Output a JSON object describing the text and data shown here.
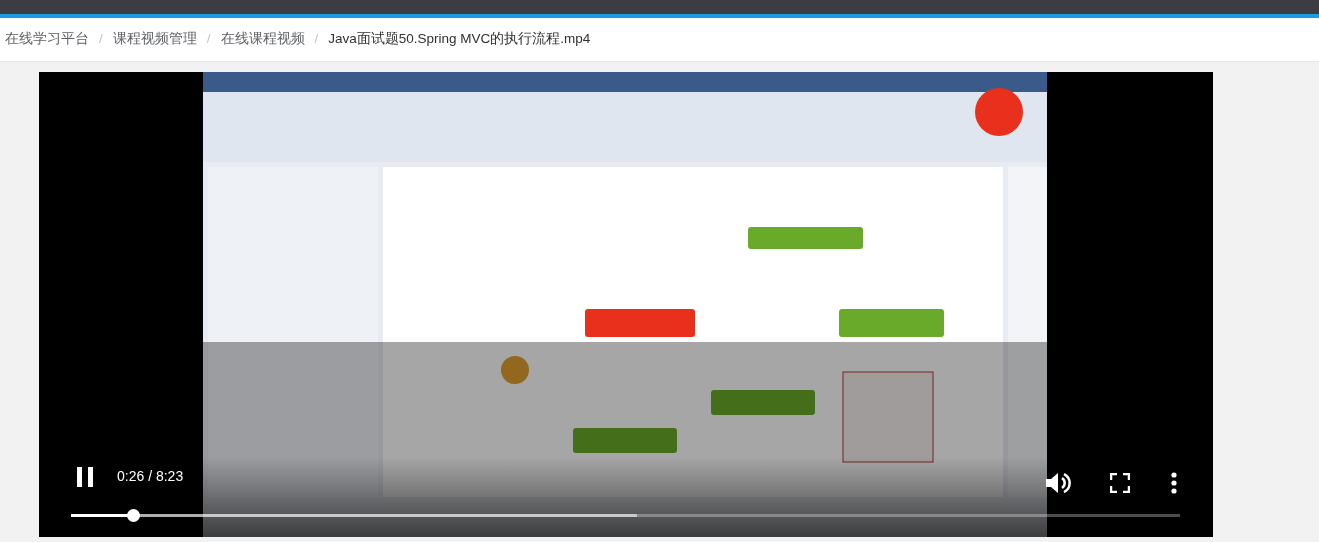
{
  "breadcrumb": [
    {
      "label": "在线学习平台",
      "selected": false
    },
    {
      "label": "课程视频管理",
      "selected": false
    },
    {
      "label": "在线课程视频",
      "selected": false
    },
    {
      "label": "Java面试题50.Spring MVC的执行流程.mp4",
      "selected": true
    }
  ],
  "separator": "/",
  "player": {
    "playing": true,
    "time": "0:26 / 8:23",
    "progress": {
      "level": 0.056
    },
    "buffered": {
      "level": 0.51
    }
  }
}
